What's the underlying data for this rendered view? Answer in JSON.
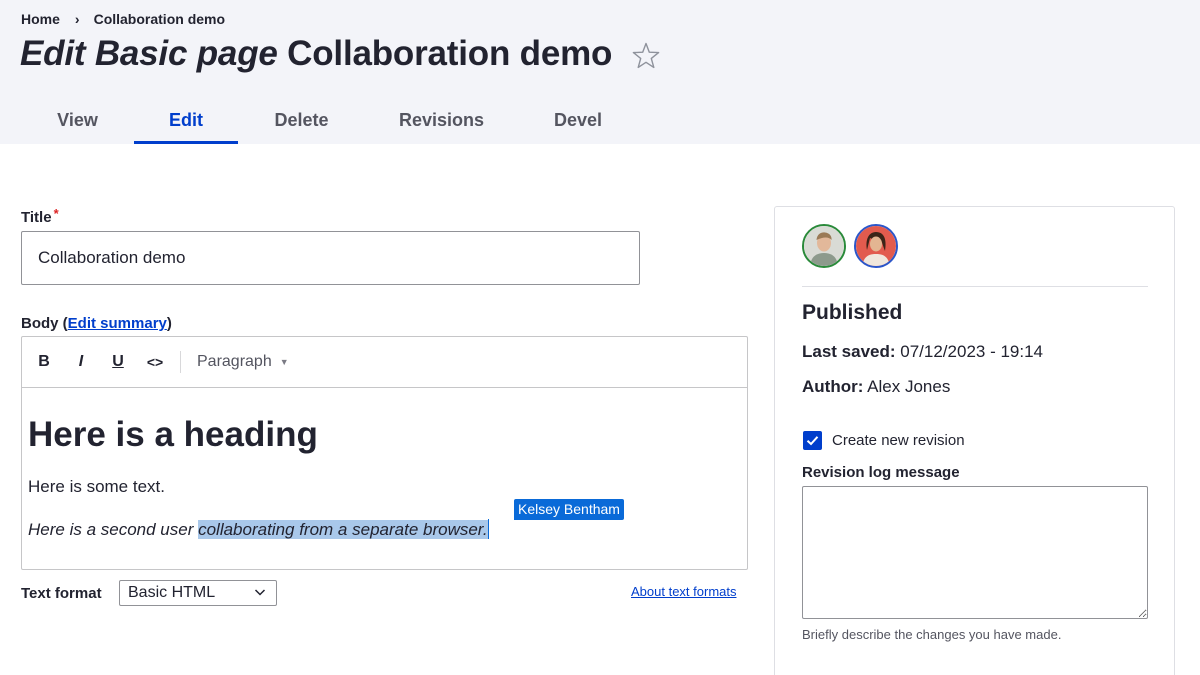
{
  "breadcrumb": {
    "home": "Home",
    "separator": "›",
    "current": "Collaboration demo"
  },
  "page_title": {
    "prefix": "Edit Basic page",
    "name": "Collaboration demo"
  },
  "tabs": [
    {
      "label": "View",
      "active": false
    },
    {
      "label": "Edit",
      "active": true
    },
    {
      "label": "Delete",
      "active": false
    },
    {
      "label": "Revisions",
      "active": false
    },
    {
      "label": "Devel",
      "active": false
    }
  ],
  "form": {
    "title_label": "Title",
    "required_marker": "*",
    "title_value": "Collaboration demo",
    "body_label": "Body",
    "body_paren_open": " (",
    "edit_summary_link": "Edit summary",
    "body_paren_close": ")",
    "toolbar": {
      "bold": "B",
      "italic": "I",
      "underline": "U",
      "code": "<>",
      "paragraph": "Paragraph"
    },
    "content": {
      "heading": "Here is a heading",
      "paragraph1": "Here is some text.",
      "paragraph2_plain": "Here is a second user ",
      "paragraph2_selected": "collaborating from a separate browser.",
      "collaborator_tag": "Kelsey Bentham"
    },
    "text_format_label": "Text format",
    "text_format_value": "Basic HTML",
    "about_link": "About text formats"
  },
  "sidebar": {
    "status": "Published",
    "last_saved_label": "Last saved:",
    "last_saved_value": " 07/12/2023 - 19:14",
    "author_label": "Author:",
    "author_value": " Alex Jones",
    "create_revision_label": "Create new revision",
    "create_revision_checked": true,
    "revision_log_label": "Revision log message",
    "revision_log_value": "",
    "revision_hint": "Briefly describe the changes you have made."
  },
  "colors": {
    "accent": "#003ecc",
    "header_bg": "#f3f4f9",
    "selection": "#a9c8ea",
    "collaborator": "#0a6ad8",
    "required": "#dc2323"
  }
}
